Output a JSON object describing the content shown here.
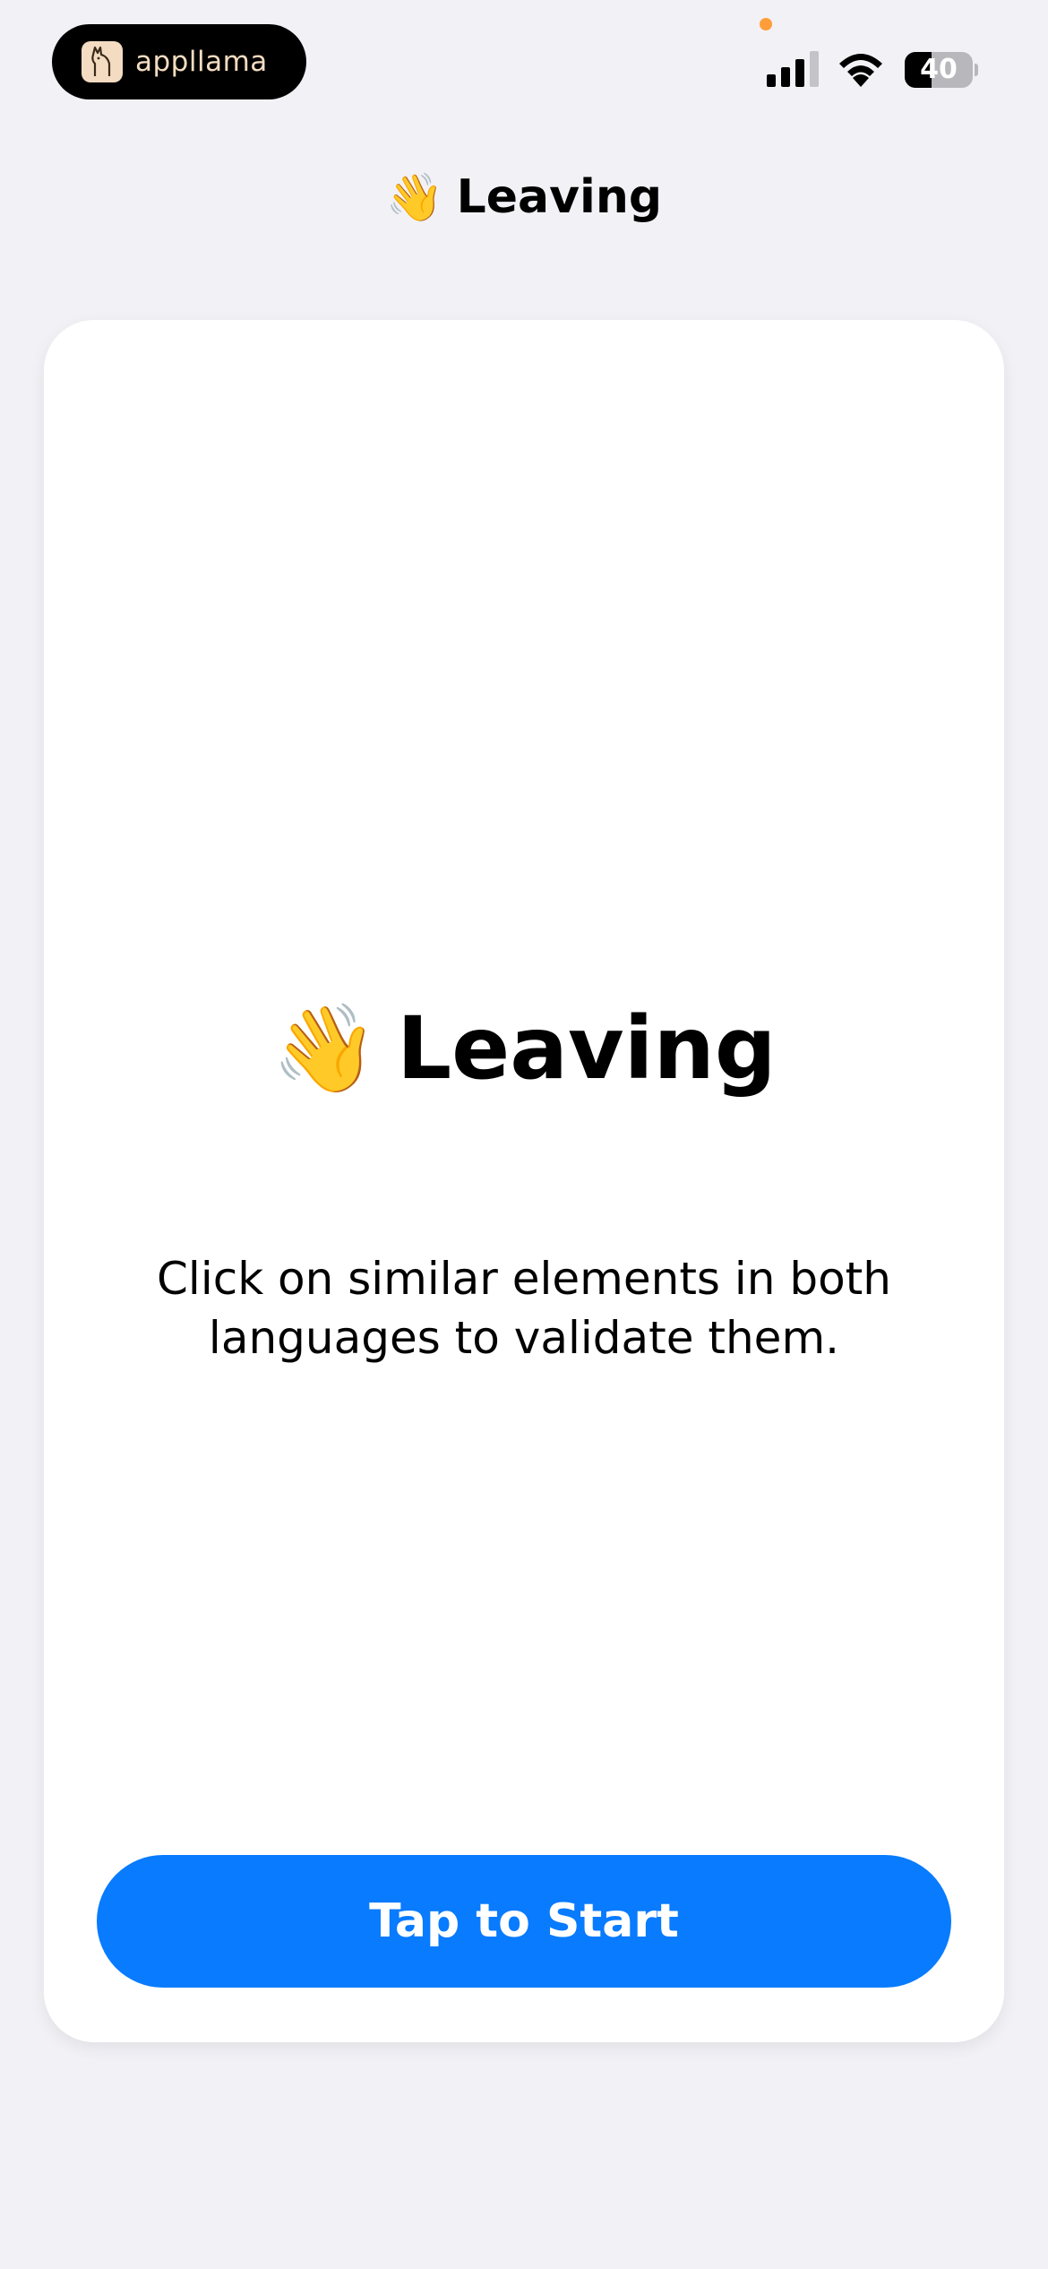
{
  "status_bar": {
    "app_name": "appllama",
    "battery_level": "40",
    "battery_percent": 40
  },
  "nav": {
    "emoji": "👋",
    "title": "Leaving"
  },
  "card": {
    "emoji": "👋",
    "title": "Leaving",
    "instructions": "Click on similar elements in both languages to validate them.",
    "start_label": "Tap to Start"
  },
  "colors": {
    "background": "#f2f1f6",
    "card": "#ffffff",
    "accent": "#087bfe",
    "logo": "#f3dcc1",
    "privacy_dot": "#ff9d3b"
  },
  "icons": {
    "app_logo": "llama-logo-icon",
    "signal": "cellular-signal-icon",
    "wifi": "wifi-icon",
    "battery": "battery-icon"
  }
}
